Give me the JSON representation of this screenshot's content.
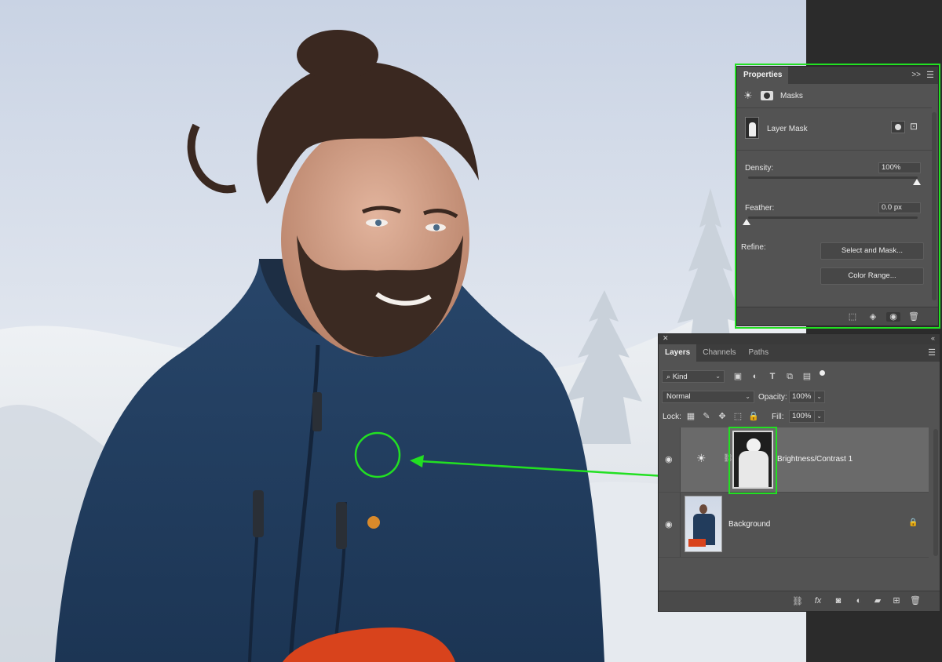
{
  "colors": {
    "accent_green": "#22e022",
    "panel_bg": "#535353",
    "tab_bg": "#3d3d3d"
  },
  "properties": {
    "tab_label": "Properties",
    "section_label": "Masks",
    "mask_type": "Layer Mask",
    "density_label": "Density:",
    "density_value": "100%",
    "feather_label": "Feather:",
    "feather_value": "0.0 px",
    "refine_label": "Refine:",
    "select_mask_label": "Select and Mask...",
    "color_range_label": "Color Range..."
  },
  "layers": {
    "tabs": [
      "Layers",
      "Channels",
      "Paths"
    ],
    "kind_label": "Kind",
    "blend_mode": "Normal",
    "opacity_label": "Opacity:",
    "opacity_value": "100%",
    "lock_label": "Lock:",
    "fill_label": "Fill:",
    "fill_value": "100%",
    "items": [
      {
        "name": "Brightness/Contrast 1",
        "icon": "brightness-contrast-icon"
      },
      {
        "name": "Background",
        "icon": "lock-icon"
      }
    ]
  }
}
